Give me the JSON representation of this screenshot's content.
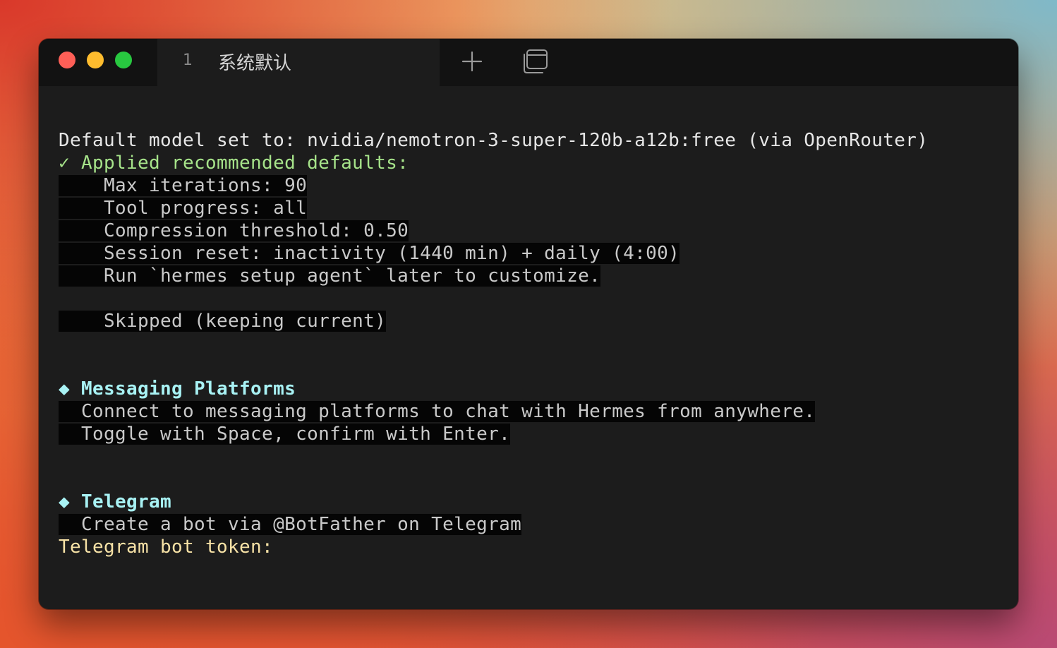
{
  "window": {
    "traffic_lights": [
      "close",
      "minimize",
      "zoom"
    ],
    "tab": {
      "index": "1",
      "title": "系统默认"
    },
    "toolbar_icons": [
      "plus-icon",
      "windows-icon"
    ],
    "colors": {
      "background": "#1c1c1c",
      "titlebar": "#121212",
      "green": "#a6e38a",
      "cyan": "#a8f2f4",
      "yellow": "#f7e2a6"
    }
  },
  "terminal": {
    "line_model": "Default model set to: nvidia/nemotron-3-super-120b-a12b:free (via OpenRouter)",
    "line_applied": "✓ Applied recommended defaults:",
    "line_max_iter": "    Max iterations: 90",
    "line_tool_progress": "    Tool progress: all",
    "line_compression": "    Compression threshold: 0.50",
    "line_session_reset": "    Session reset: inactivity (1440 min) + daily (4:00)",
    "line_run_hint": "    Run `hermes setup agent` later to customize.",
    "line_skipped": "    Skipped (keeping current)",
    "section_messaging": "◆ Messaging Platforms",
    "line_connect": "  Connect to messaging platforms to chat with Hermes from anywhere.",
    "line_toggle": "  Toggle with Space, confirm with Enter.",
    "section_telegram": "◆ Telegram",
    "line_create_bot": "  Create a bot via @BotFather on Telegram",
    "prompt_token": "Telegram bot token:"
  }
}
